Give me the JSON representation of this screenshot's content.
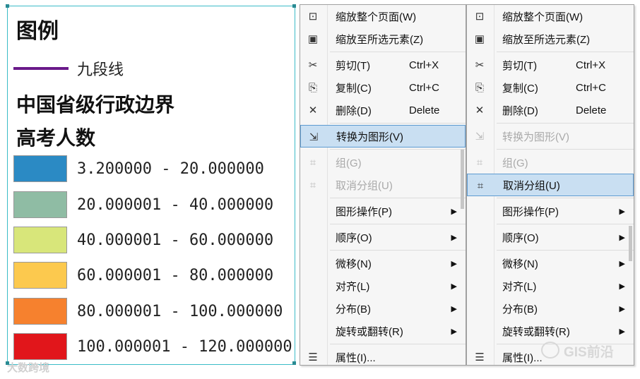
{
  "legend": {
    "title": "图例",
    "line_label": "九段线",
    "line_color": "#6a1a8a",
    "layer_title": "中国省级行政边界",
    "field_title": "高考人数",
    "classes": [
      {
        "label": "3.200000 - 20.000000",
        "color": "#2b8ac4"
      },
      {
        "label": "20.000001 - 40.000000",
        "color": "#8fbca4"
      },
      {
        "label": "40.000001 - 60.000000",
        "color": "#d8e67a"
      },
      {
        "label": "60.000001 - 80.000000",
        "color": "#fcc94e"
      },
      {
        "label": "80.000001 - 100.000000",
        "color": "#f6812e"
      },
      {
        "label": "100.000001 - 120.000000",
        "color": "#e1161b"
      }
    ]
  },
  "watermark_left": "大数跨境",
  "watermark_right": "GIS前沿",
  "menus": [
    {
      "items": [
        {
          "icon": "zoom-page-icon",
          "glyph": "⊡",
          "label": "缩放整个页面(W)",
          "shortcut": "",
          "submenu": false,
          "state": "normal"
        },
        {
          "icon": "zoom-selected-icon",
          "glyph": "▣",
          "label": "缩放至所选元素(Z)",
          "shortcut": "",
          "submenu": false,
          "state": "normal"
        },
        {
          "sep": true
        },
        {
          "icon": "scissors-icon",
          "glyph": "✂",
          "label": "剪切(T)",
          "shortcut": "Ctrl+X",
          "submenu": false,
          "state": "normal"
        },
        {
          "icon": "copy-icon",
          "glyph": "⎘",
          "label": "复制(C)",
          "shortcut": "Ctrl+C",
          "submenu": false,
          "state": "normal"
        },
        {
          "icon": "delete-icon",
          "glyph": "✕",
          "label": "删除(D)",
          "shortcut": "Delete",
          "submenu": false,
          "state": "normal"
        },
        {
          "sep": true
        },
        {
          "icon": "convert-graphics-icon",
          "glyph": "⇲",
          "label": "转换为图形(V)",
          "shortcut": "",
          "submenu": false,
          "state": "highlighted"
        },
        {
          "sep": true
        },
        {
          "icon": "group-icon",
          "glyph": "⌗",
          "label": "组(G)",
          "shortcut": "",
          "submenu": false,
          "state": "disabled"
        },
        {
          "icon": "ungroup-icon",
          "glyph": "⌗",
          "label": "取消分组(U)",
          "shortcut": "",
          "submenu": false,
          "state": "disabled"
        },
        {
          "sep": true
        },
        {
          "icon": "",
          "glyph": "",
          "label": "图形操作(P)",
          "shortcut": "",
          "submenu": true,
          "state": "normal"
        },
        {
          "sep": true
        },
        {
          "icon": "",
          "glyph": "",
          "label": "顺序(O)",
          "shortcut": "",
          "submenu": true,
          "state": "normal"
        },
        {
          "sep": true
        },
        {
          "icon": "",
          "glyph": "",
          "label": "微移(N)",
          "shortcut": "",
          "submenu": true,
          "state": "normal"
        },
        {
          "icon": "",
          "glyph": "",
          "label": "对齐(L)",
          "shortcut": "",
          "submenu": true,
          "state": "normal"
        },
        {
          "icon": "",
          "glyph": "",
          "label": "分布(B)",
          "shortcut": "",
          "submenu": true,
          "state": "normal"
        },
        {
          "icon": "",
          "glyph": "",
          "label": "旋转或翻转(R)",
          "shortcut": "",
          "submenu": true,
          "state": "normal"
        },
        {
          "sep": true
        },
        {
          "icon": "properties-icon",
          "glyph": "☰",
          "label": "属性(I)...",
          "shortcut": "",
          "submenu": false,
          "state": "normal"
        }
      ]
    },
    {
      "items": [
        {
          "icon": "zoom-page-icon",
          "glyph": "⊡",
          "label": "缩放整个页面(W)",
          "shortcut": "",
          "submenu": false,
          "state": "normal"
        },
        {
          "icon": "zoom-selected-icon",
          "glyph": "▣",
          "label": "缩放至所选元素(Z)",
          "shortcut": "",
          "submenu": false,
          "state": "normal"
        },
        {
          "sep": true
        },
        {
          "icon": "scissors-icon",
          "glyph": "✂",
          "label": "剪切(T)",
          "shortcut": "Ctrl+X",
          "submenu": false,
          "state": "normal"
        },
        {
          "icon": "copy-icon",
          "glyph": "⎘",
          "label": "复制(C)",
          "shortcut": "Ctrl+C",
          "submenu": false,
          "state": "normal"
        },
        {
          "icon": "delete-icon",
          "glyph": "✕",
          "label": "删除(D)",
          "shortcut": "Delete",
          "submenu": false,
          "state": "normal"
        },
        {
          "sep": true
        },
        {
          "icon": "convert-graphics-icon",
          "glyph": "⇲",
          "label": "转换为图形(V)",
          "shortcut": "",
          "submenu": false,
          "state": "disabled"
        },
        {
          "sep": true
        },
        {
          "icon": "group-icon",
          "glyph": "⌗",
          "label": "组(G)",
          "shortcut": "",
          "submenu": false,
          "state": "disabled"
        },
        {
          "icon": "ungroup-icon",
          "glyph": "⌗",
          "label": "取消分组(U)",
          "shortcut": "",
          "submenu": false,
          "state": "highlighted"
        },
        {
          "sep": true
        },
        {
          "icon": "",
          "glyph": "",
          "label": "图形操作(P)",
          "shortcut": "",
          "submenu": true,
          "state": "normal"
        },
        {
          "sep": true
        },
        {
          "icon": "",
          "glyph": "",
          "label": "顺序(O)",
          "shortcut": "",
          "submenu": true,
          "state": "normal"
        },
        {
          "sep": true
        },
        {
          "icon": "",
          "glyph": "",
          "label": "微移(N)",
          "shortcut": "",
          "submenu": true,
          "state": "normal"
        },
        {
          "icon": "",
          "glyph": "",
          "label": "对齐(L)",
          "shortcut": "",
          "submenu": true,
          "state": "normal"
        },
        {
          "icon": "",
          "glyph": "",
          "label": "分布(B)",
          "shortcut": "",
          "submenu": true,
          "state": "normal"
        },
        {
          "icon": "",
          "glyph": "",
          "label": "旋转或翻转(R)",
          "shortcut": "",
          "submenu": true,
          "state": "normal"
        },
        {
          "sep": true
        },
        {
          "icon": "properties-icon",
          "glyph": "☰",
          "label": "属性(I)...",
          "shortcut": "",
          "submenu": false,
          "state": "normal"
        }
      ]
    }
  ]
}
